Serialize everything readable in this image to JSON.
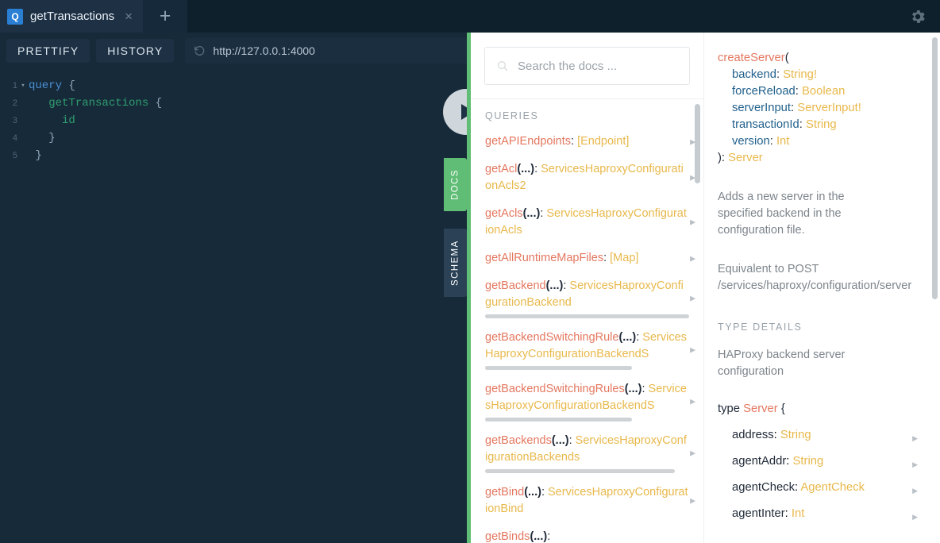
{
  "window": {
    "tab": {
      "badge": "Q",
      "title": "getTransactions",
      "close": "×"
    },
    "new_tab": "+",
    "gear_icon": "gear-icon"
  },
  "toolbar": {
    "prettify": "PRETTIFY",
    "history": "HISTORY",
    "url": "http://127.0.0.1:4000",
    "reload_icon": "reload-icon"
  },
  "editor": {
    "lines": [
      {
        "num": "1",
        "fold": "▾",
        "text": "query {",
        "parts": [
          {
            "t": "query ",
            "c": "k-kw"
          },
          {
            "t": "{",
            "c": "k-punc"
          }
        ]
      },
      {
        "num": "2",
        "fold": "",
        "text": "  getTransactions {",
        "parts": [
          {
            "t": "    ",
            "c": "k-punc"
          },
          {
            "t": "getTransactions ",
            "c": "k-fld"
          },
          {
            "t": "{",
            "c": "k-punc"
          }
        ]
      },
      {
        "num": "3",
        "fold": "",
        "text": "    id",
        "parts": [
          {
            "t": "      ",
            "c": "k-punc"
          },
          {
            "t": "id",
            "c": "k-fld"
          }
        ]
      },
      {
        "num": "4",
        "fold": "",
        "text": "  }",
        "parts": [
          {
            "t": "    }",
            "c": "k-punc"
          }
        ]
      },
      {
        "num": "5",
        "fold": "",
        "text": "}",
        "parts": [
          {
            "t": "  }",
            "c": "k-punc"
          }
        ]
      }
    ]
  },
  "run_button": {
    "label": "play-button"
  },
  "side_tabs": {
    "docs": "DOCS",
    "schema": "SCHEMA"
  },
  "docs": {
    "search_placeholder": "Search the docs ...",
    "section_title": "QUERIES",
    "items": [
      {
        "name": "getAPIEndpoints",
        "args": "",
        "type": "[Endpoint]",
        "scrollbar": false
      },
      {
        "name": "getAcl",
        "args": "(...)",
        "type": "ServicesHaproxyConfigurationAcls2",
        "scrollbar": false
      },
      {
        "name": "getAcls",
        "args": "(...)",
        "type": "ServicesHaproxyConfigurationAcls",
        "scrollbar": false
      },
      {
        "name": "getAllRuntimeMapFiles",
        "args": "",
        "type": "[Map]",
        "scrollbar": false
      },
      {
        "name": "getBackend",
        "args": "(...)",
        "type": "ServicesHaproxyConfigurationBackend",
        "scrollbar": true
      },
      {
        "name": "getBackendSwitchingRule",
        "args": "(...)",
        "type": "ServicesHaproxyConfigurationBackendS",
        "scrollbar": true
      },
      {
        "name": "getBackendSwitchingRules",
        "args": "(...)",
        "type": "ServicesHaproxyConfigurationBackendS",
        "scrollbar": true
      },
      {
        "name": "getBackends",
        "args": "(...)",
        "type": "ServicesHaproxyConfigurationBackends",
        "scrollbar": true
      },
      {
        "name": "getBind",
        "args": "(...)",
        "type": "ServicesHaproxyConfigurationBind",
        "scrollbar": false
      },
      {
        "name": "getBinds",
        "args": "(...)",
        "type": "",
        "scrollbar": false
      }
    ]
  },
  "type_panel": {
    "signature": {
      "fn": "createServer",
      "open": "(",
      "args": [
        {
          "name": "backend",
          "type": "String!"
        },
        {
          "name": "forceReload",
          "type": "Boolean"
        },
        {
          "name": "serverInput",
          "type": "ServerInput!"
        },
        {
          "name": "transactionId",
          "type": "String"
        },
        {
          "name": "version",
          "type": "Int"
        }
      ],
      "close": "): ",
      "return_type": "Server"
    },
    "description_1": "Adds a new server in the specified backend in the configuration file.",
    "description_2a": "Equivalent to POST",
    "description_2b": "/services/haproxy/configuration/server",
    "type_details_header": "TYPE DETAILS",
    "type_description": "HAProxy backend server configuration",
    "type_decl_kw": "type",
    "type_decl_name": "Server",
    "type_decl_brace": "{",
    "fields": [
      {
        "name": "address",
        "type": "String"
      },
      {
        "name": "agentAddr",
        "type": "String"
      },
      {
        "name": "agentCheck",
        "type": "AgentCheck"
      },
      {
        "name": "agentInter",
        "type": "Int"
      }
    ]
  },
  "colors": {
    "chrome_bg": "#0f202d",
    "editor_bg": "#172a3a",
    "accent_green": "#5fbd75",
    "field_pink": "#d64292",
    "query_orange": "#e4775f",
    "type_yellow": "#e8b84b",
    "arg_blue": "#1f5f8b",
    "badge_blue": "#2a7ed3"
  }
}
